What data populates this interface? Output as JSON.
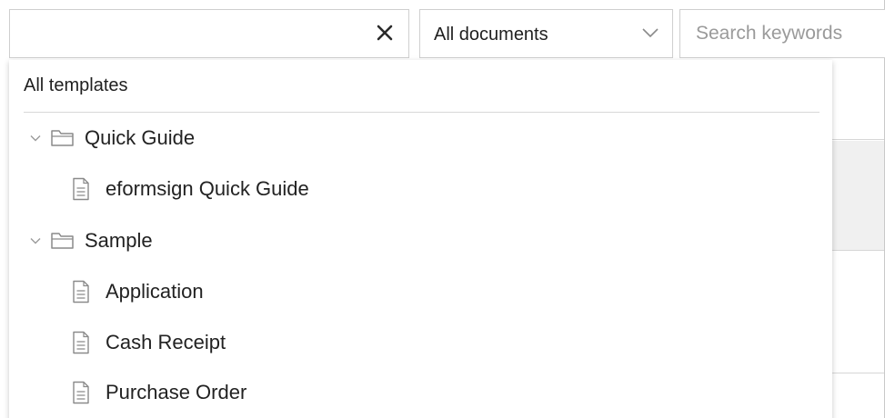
{
  "filter_bar": {
    "template_combo": {
      "value": "",
      "clear_icon": "close-icon"
    },
    "document_select": {
      "selected": "All documents",
      "icon": "chevron-down-icon"
    },
    "search": {
      "placeholder": "Search keywords",
      "value": ""
    }
  },
  "template_dropdown": {
    "header": "All templates",
    "folders": [
      {
        "label": "Quick Guide",
        "expanded": true,
        "items": [
          {
            "label": "eformsign Quick Guide"
          }
        ]
      },
      {
        "label": "Sample",
        "expanded": true,
        "items": [
          {
            "label": "Application"
          },
          {
            "label": "Cash Receipt"
          },
          {
            "label": "Purchase Order"
          }
        ]
      }
    ]
  },
  "colors": {
    "border": "#cfcfcf",
    "placeholder": "#9a9a9a",
    "text": "#1f1f1f",
    "icon": "#8a8a8a",
    "divider": "#d8d8d8"
  }
}
